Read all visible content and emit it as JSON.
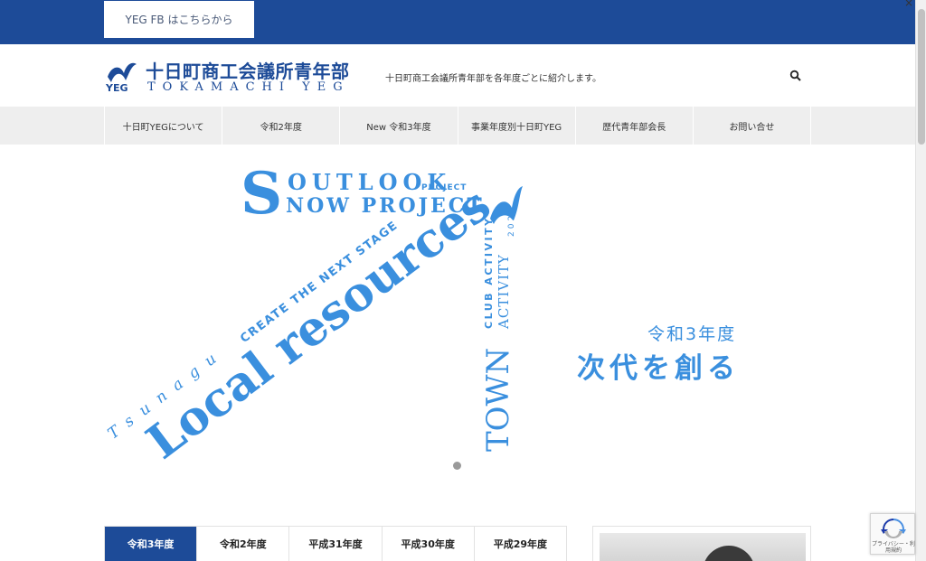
{
  "topbar": {
    "fb_label": "YEG FB はこちらから"
  },
  "header": {
    "logo_jp": "十日町商工会議所青年部",
    "logo_en": "TOKAMACHI YEG",
    "logo_yeg": "YEG",
    "tagline": "十日町商工会議所青年部を各年度ごとに紹介します。"
  },
  "nav": {
    "items": [
      {
        "label": "十日町YEGについて"
      },
      {
        "label": "令和2年度"
      },
      {
        "label": "New 令和3年度"
      },
      {
        "label": "事業年度別十日町YEG"
      },
      {
        "label": "歴代青年部会長"
      },
      {
        "label": "お問い合せ"
      }
    ]
  },
  "hero": {
    "outlook": "OUTLOOK",
    "project_small": "PROJECT",
    "now_project": "NOW PROJECT",
    "big_s": "S",
    "create": "CREATE THE NEXT STAGE",
    "local": "Local resources",
    "tsunagu": "Tsunagu",
    "club": "CLUB ACTIVITY",
    "year": "2021",
    "town": "TOWN",
    "activity": "ACTIVITY",
    "reiwa": "令和3年度",
    "jidai": "次代を創る"
  },
  "year_tabs": [
    {
      "label": "令和3年度",
      "active": true
    },
    {
      "label": "令和2年度",
      "active": false
    },
    {
      "label": "平成31年度",
      "active": false
    },
    {
      "label": "平成30年度",
      "active": false
    },
    {
      "label": "平成29年度",
      "active": false
    }
  ],
  "recaptcha": {
    "text": "プライバシー・利用規約"
  },
  "colors": {
    "brand": "#1d4b98",
    "hero_blue": "#3a8fde",
    "nav_bg": "#eeeeee"
  }
}
